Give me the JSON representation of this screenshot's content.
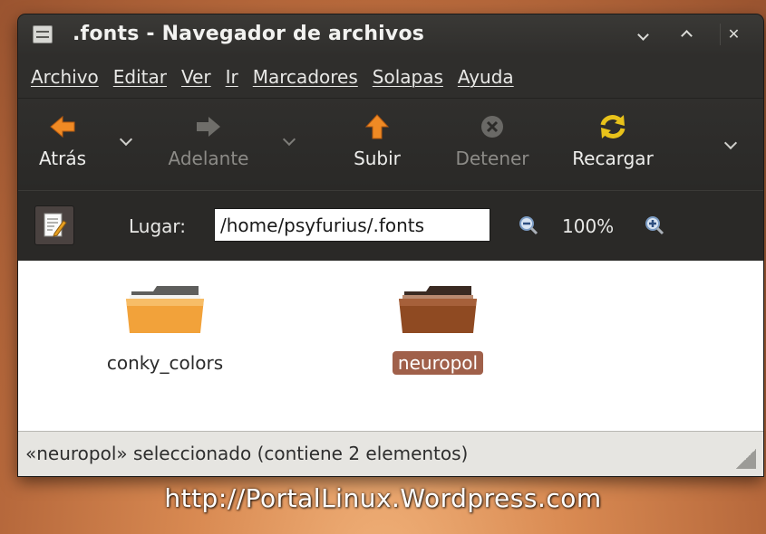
{
  "window": {
    "title": ".fonts - Navegador de archivos"
  },
  "menubar": {
    "items": [
      "Archivo",
      "Editar",
      "Ver",
      "Ir",
      "Marcadores",
      "Solapas",
      "Ayuda"
    ]
  },
  "toolbar": {
    "back_label": "Atrás",
    "forward_label": "Adelante",
    "up_label": "Subir",
    "stop_label": "Detener",
    "reload_label": "Recargar"
  },
  "location": {
    "label": "Lugar:",
    "path": "/home/psyfurius/.fonts",
    "zoom": "100%"
  },
  "files": [
    {
      "name": "conky_colors",
      "selected": false,
      "color": "#f2a23a"
    },
    {
      "name": "neuropol",
      "selected": true,
      "color": "#8f4a22"
    }
  ],
  "status": {
    "text": "«neuropol» seleccionado (contiene 2 elementos)"
  },
  "watermark": "http://PortalLinux.Wordpress.com",
  "colors": {
    "accent_orange": "#f08a24",
    "selection": "#a0604a",
    "reload_yellow": "#e8c21a"
  }
}
